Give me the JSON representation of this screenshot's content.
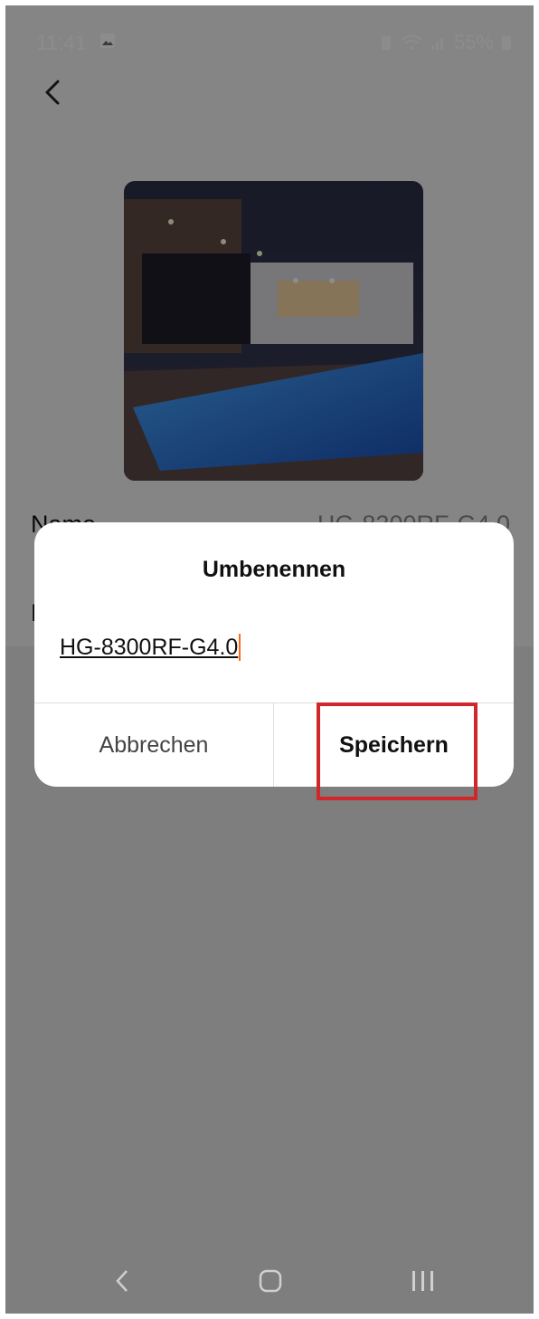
{
  "status": {
    "time": "11:41",
    "battery": "55%"
  },
  "page": {
    "name_label": "Name",
    "name_value": "HG-8300RF-G4.0",
    "second_row_label": "L"
  },
  "dialog": {
    "title": "Umbenennen",
    "input_value": "HG-8300RF-G4.0",
    "cancel_label": "Abbrechen",
    "save_label": "Speichern",
    "highlight_color": "#d1262a",
    "caret_color": "#ff6a13"
  },
  "icons": {
    "back": "chevron-left-icon",
    "nav_back": "nav-back-icon",
    "nav_home": "nav-home-icon",
    "nav_recents": "nav-recents-icon"
  }
}
